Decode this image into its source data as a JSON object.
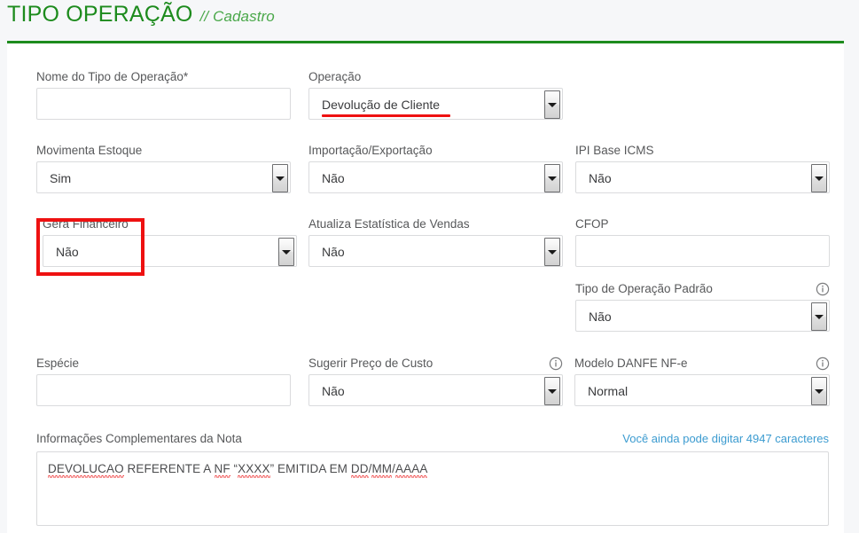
{
  "header": {
    "title": "TIPO OPERAÇÃO",
    "subtitle": "// Cadastro",
    "accent_color": "#1d8b1d"
  },
  "form": {
    "fields": [
      {
        "key": "nome_tipo_operacao",
        "label": "Nome do Tipo de Operação*",
        "type": "text",
        "value": "",
        "placeholder": ""
      },
      {
        "key": "operacao",
        "label": "Operação",
        "type": "select",
        "value": "Devolução de Cliente"
      },
      {
        "key": "movimenta_estoque",
        "label": "Movimenta Estoque",
        "type": "select",
        "value": "Sim"
      },
      {
        "key": "importacao_exportacao",
        "label": "Importação/Exportação",
        "type": "select",
        "value": "Não"
      },
      {
        "key": "ipi_base_icms",
        "label": "IPI Base ICMS",
        "type": "select",
        "value": "Não"
      },
      {
        "key": "gera_financeiro",
        "label": "Gera Financeiro",
        "type": "select",
        "value": "Não"
      },
      {
        "key": "atualiza_estatistica_vendas",
        "label": "Atualiza Estatística de Vendas",
        "type": "select",
        "value": "Não"
      },
      {
        "key": "cfop",
        "label": "CFOP",
        "type": "text",
        "value": "",
        "placeholder": ""
      },
      {
        "key": "tipo_operacao_padrao",
        "label": "Tipo de Operação Padrão",
        "type": "select",
        "value": "Não",
        "info_icon": "info-circle-icon"
      },
      {
        "key": "especie",
        "label": "Espécie",
        "type": "text",
        "value": "",
        "placeholder": ""
      },
      {
        "key": "sugerir_preco_custo",
        "label": "Sugerir Preço de Custo",
        "type": "select",
        "value": "Não",
        "info_icon": "info-circle-icon"
      },
      {
        "key": "modelo_danfe_nfe",
        "label": "Modelo DANFE NF-e",
        "type": "select",
        "value": "Normal",
        "info_icon": "info-circle-icon"
      }
    ],
    "notes": {
      "label": "Informações Complementares da Nota",
      "counter": "Você ainda pode digitar 4947 caracteres",
      "counter_color": "#3b9bd0",
      "value_parts": [
        {
          "text": "DEVOLUCAO",
          "misspelled": true
        },
        {
          "text": " REFERENTE A ",
          "misspelled": false
        },
        {
          "text": "NF",
          "misspelled": true
        },
        {
          "text": " “",
          "misspelled": false
        },
        {
          "text": "XXXX",
          "misspelled": true
        },
        {
          "text": "” EMITIDA EM ",
          "misspelled": false
        },
        {
          "text": "DD",
          "misspelled": true
        },
        {
          "text": "/",
          "misspelled": false
        },
        {
          "text": "MM",
          "misspelled": true
        },
        {
          "text": "/",
          "misspelled": false
        },
        {
          "text": "AAAA",
          "misspelled": true
        }
      ]
    }
  },
  "annotations": {
    "color": "#ee1111",
    "underline_operacao": "red underline under Devolução de Cliente",
    "box_gera_financeiro": "red rectangle around Gera Financeiro field"
  }
}
